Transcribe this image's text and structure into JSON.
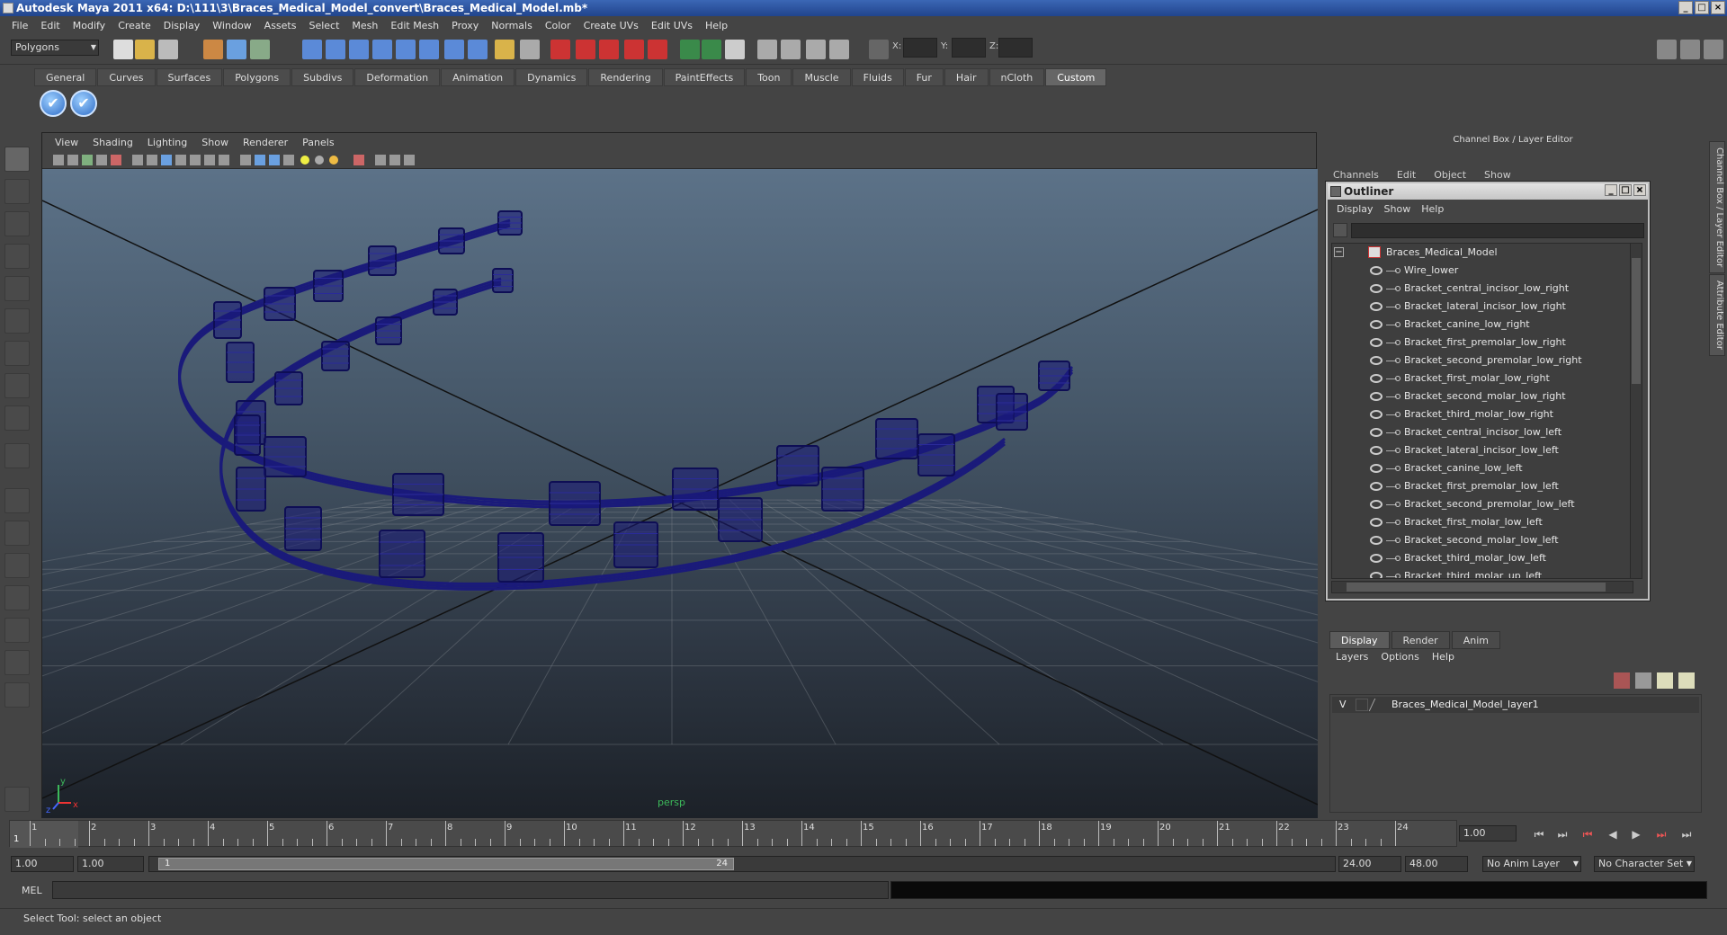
{
  "window": {
    "title": "Autodesk Maya 2011 x64: D:\\111\\3\\Braces_Medical_Model_convert\\Braces_Medical_Model.mb*"
  },
  "menubar": [
    "File",
    "Edit",
    "Modify",
    "Create",
    "Display",
    "Window",
    "Assets",
    "Select",
    "Mesh",
    "Edit Mesh",
    "Proxy",
    "Normals",
    "Color",
    "Create UVs",
    "Edit UVs",
    "Help"
  ],
  "statusline": {
    "mode": "Polygons",
    "x_label": "X:",
    "y_label": "Y:",
    "z_label": "Z:"
  },
  "shelf": {
    "tabs": [
      "General",
      "Curves",
      "Surfaces",
      "Polygons",
      "Subdivs",
      "Deformation",
      "Animation",
      "Dynamics",
      "Rendering",
      "PaintEffects",
      "Toon",
      "Muscle",
      "Fluids",
      "Fur",
      "Hair",
      "nCloth",
      "Custom"
    ],
    "active": "Custom",
    "check_glyph": "✔"
  },
  "viewport": {
    "menu": [
      "View",
      "Shading",
      "Lighting",
      "Show",
      "Renderer",
      "Panels"
    ],
    "camera": "persp",
    "wire_color": "#1a1a7a",
    "axis": {
      "x": "x",
      "y": "y",
      "z": "z"
    }
  },
  "channelbox": {
    "title": "Channel Box / Layer Editor",
    "menu": [
      "Channels",
      "Edit",
      "Object",
      "Show"
    ],
    "side_tabs": [
      "Channel Box / Layer Editor",
      "Attribute Editor"
    ]
  },
  "outliner": {
    "title": "Outliner",
    "menu": [
      "Display",
      "Show",
      "Help"
    ],
    "root": "Braces_Medical_Model",
    "collapse_glyph": "−",
    "items": [
      "Wire_lower",
      "Bracket_central_incisor_low_right",
      "Bracket_lateral_incisor_low_right",
      "Bracket_canine_low_right",
      "Bracket_first_premolar_low_right",
      "Bracket_second_premolar_low_right",
      "Bracket_first_molar_low_right",
      "Bracket_second_molar_low_right",
      "Bracket_third_molar_low_right",
      "Bracket_central_incisor_low_left",
      "Bracket_lateral_incisor_low_left",
      "Bracket_canine_low_left",
      "Bracket_first_premolar_low_left",
      "Bracket_second_premolar_low_left",
      "Bracket_first_molar_low_left",
      "Bracket_second_molar_low_left",
      "Bracket_third_molar_low_left",
      "Bracket_third_molar_up_left"
    ]
  },
  "layers": {
    "tabs": [
      "Display",
      "Render",
      "Anim"
    ],
    "active": "Display",
    "menu": [
      "Layers",
      "Options",
      "Help"
    ],
    "row": {
      "visible": "V",
      "name": "Braces_Medical_Model_layer1"
    }
  },
  "timeline": {
    "ticks": [
      "1",
      "2",
      "3",
      "4",
      "5",
      "6",
      "7",
      "8",
      "9",
      "10",
      "11",
      "12",
      "13",
      "14",
      "15",
      "16",
      "17",
      "18",
      "19",
      "20",
      "21",
      "22",
      "23",
      "24"
    ],
    "current_frame": "1",
    "current_field": "1.00",
    "playback": [
      "⏮",
      "⏭",
      "⏮",
      "◀",
      "▶",
      "⏭",
      "⏭"
    ]
  },
  "range": {
    "start": "1.00",
    "anim_start": "1.00",
    "slider_start": "1",
    "slider_end": "24",
    "anim_end": "24.00",
    "end": "48.00",
    "anim_layer": "No Anim Layer",
    "char_set": "No Character Set"
  },
  "mel": {
    "label": "MEL"
  },
  "helpline": {
    "text": "Select Tool: select an object"
  }
}
